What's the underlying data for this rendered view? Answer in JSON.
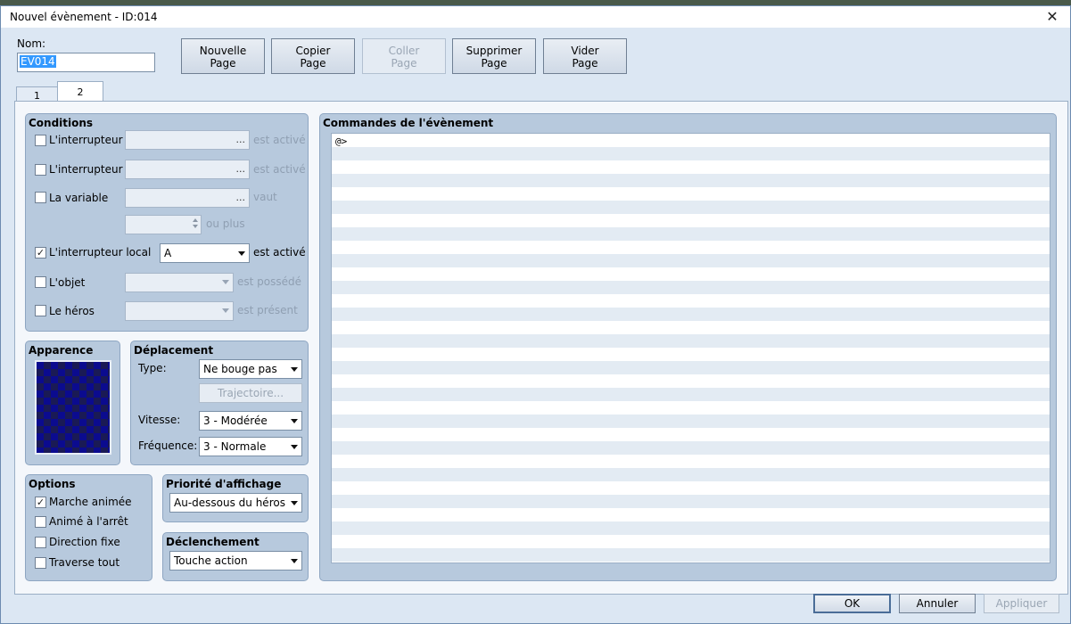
{
  "window": {
    "title": "Nouvel évènement - ID:014",
    "close_glyph": "✕"
  },
  "name": {
    "label": "Nom:",
    "value": "EV014"
  },
  "toolbar": {
    "new_page": [
      "Nouvelle",
      "Page"
    ],
    "copy_page": [
      "Copier",
      "Page"
    ],
    "paste_page": [
      "Coller",
      "Page"
    ],
    "delete_page": [
      "Supprimer",
      "Page"
    ],
    "clear_page": [
      "Vider",
      "Page"
    ]
  },
  "tabs": [
    {
      "label": "1"
    },
    {
      "label": "2",
      "active": true
    }
  ],
  "conditions": {
    "title": "Conditions",
    "switch1": {
      "label": "L'interrupteur",
      "checked": false,
      "value": "",
      "suffix": "est activé"
    },
    "switch2": {
      "label": "L'interrupteur",
      "checked": false,
      "value": "",
      "suffix": "est activé"
    },
    "variable": {
      "label": "La variable",
      "checked": false,
      "value": "",
      "suffix": "vaut",
      "number_suffix": "ou plus"
    },
    "self_switch": {
      "label": "L'interrupteur local",
      "checked": true,
      "value": "A",
      "suffix": "est activé"
    },
    "item": {
      "label": "L'objet",
      "checked": false,
      "suffix": "est possédé"
    },
    "actor": {
      "label": "Le héros",
      "checked": false,
      "suffix": "est présent"
    }
  },
  "appearance": {
    "title": "Apparence"
  },
  "movement": {
    "title": "Déplacement",
    "type_label": "Type:",
    "type_value": "Ne bouge pas",
    "route_button": "Trajectoire...",
    "speed_label": "Vitesse:",
    "speed_value": "3 - Modérée",
    "freq_label": "Fréquence:",
    "freq_value": "3 - Normale"
  },
  "options": {
    "title": "Options",
    "items": [
      {
        "label": "Marche animée",
        "checked": true
      },
      {
        "label": "Animé à l'arrêt",
        "checked": false
      },
      {
        "label": "Direction fixe",
        "checked": false
      },
      {
        "label": "Traverse tout",
        "checked": false
      }
    ]
  },
  "priority": {
    "title": "Priorité d'affichage",
    "value": "Au-dessous du héros"
  },
  "trigger": {
    "title": "Déclenchement",
    "value": "Touche action"
  },
  "commands": {
    "title": "Commandes de l'évènement",
    "lines": [
      "@>"
    ]
  },
  "footer": {
    "ok": "OK",
    "cancel": "Annuler",
    "apply": "Appliquer"
  },
  "colors": {
    "panel": "#b7c9dd",
    "window": "#dce7f3",
    "selection": "#3399ff"
  }
}
